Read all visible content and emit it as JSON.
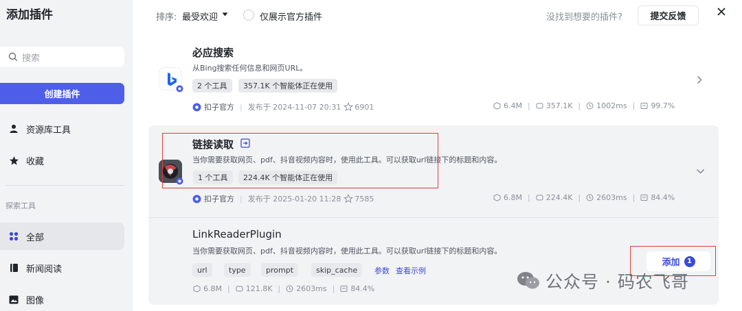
{
  "sidebar": {
    "title": "添加插件",
    "search_placeholder": "搜索",
    "create_label": "创建插件",
    "items": [
      {
        "label": "资源库工具",
        "icon": "person-icon"
      },
      {
        "label": "收藏",
        "icon": "star-icon"
      }
    ],
    "section_label": "探索工具",
    "categories": [
      {
        "label": "全部",
        "icon": "grid-icon",
        "active": true
      },
      {
        "label": "新闻阅读",
        "icon": "book-icon"
      },
      {
        "label": "图像",
        "icon": "image-icon"
      }
    ]
  },
  "toolbar": {
    "sort_label": "排序:",
    "sort_value": "最受欢迎",
    "official_only_label": "仅展示官方插件",
    "not_found_text": "没找到想要的插件?",
    "feedback_label": "提交反馈"
  },
  "plugins": [
    {
      "name": "必应搜索",
      "description": "从Bing搜索任何信息和网页URL。",
      "tags": [
        "2 个工具",
        "357.1K 个智能体正在使用"
      ],
      "publisher": "扣子官方",
      "published": "发布于 2024-11-07 20:31",
      "favorites": "6901",
      "stats": {
        "size": "6.4M",
        "bots": "357.1K",
        "latency": "1002ms",
        "success": "99.7%"
      },
      "accent": "#1e66f5"
    },
    {
      "name": "链接读取",
      "description": "当你需要获取网页、pdf、抖音视频内容时，使用此工具。可以获取url链接下的标题和内容。",
      "tags": [
        "1 个工具",
        "224.4K 个智能体正在使用"
      ],
      "publisher": "扣子官方",
      "published": "发布于 2025-01-20 11:28",
      "favorites": "7585",
      "stats": {
        "size": "6.8M",
        "bots": "224.4K",
        "latency": "2603ms",
        "success": "84.4%"
      }
    }
  ],
  "tool": {
    "name": "LinkReaderPlugin",
    "description": "当你需要获取网页、pdf、抖音视频内容时，使用此工具。可以获取url链接下的标题和内容。",
    "params": [
      "url",
      "type",
      "prompt",
      "skip_cache"
    ],
    "params_link": "参数",
    "example_link": "查看示例",
    "stats": {
      "size": "6.8M",
      "bots": "121.8K",
      "latency": "2603ms",
      "success": "84.4%"
    },
    "add_label": "添加",
    "add_count": "1"
  },
  "watermark": "公众号 · 码农飞哥",
  "colors": {
    "primary": "#4e5ee8",
    "highlight_border": "#e23b3b"
  }
}
